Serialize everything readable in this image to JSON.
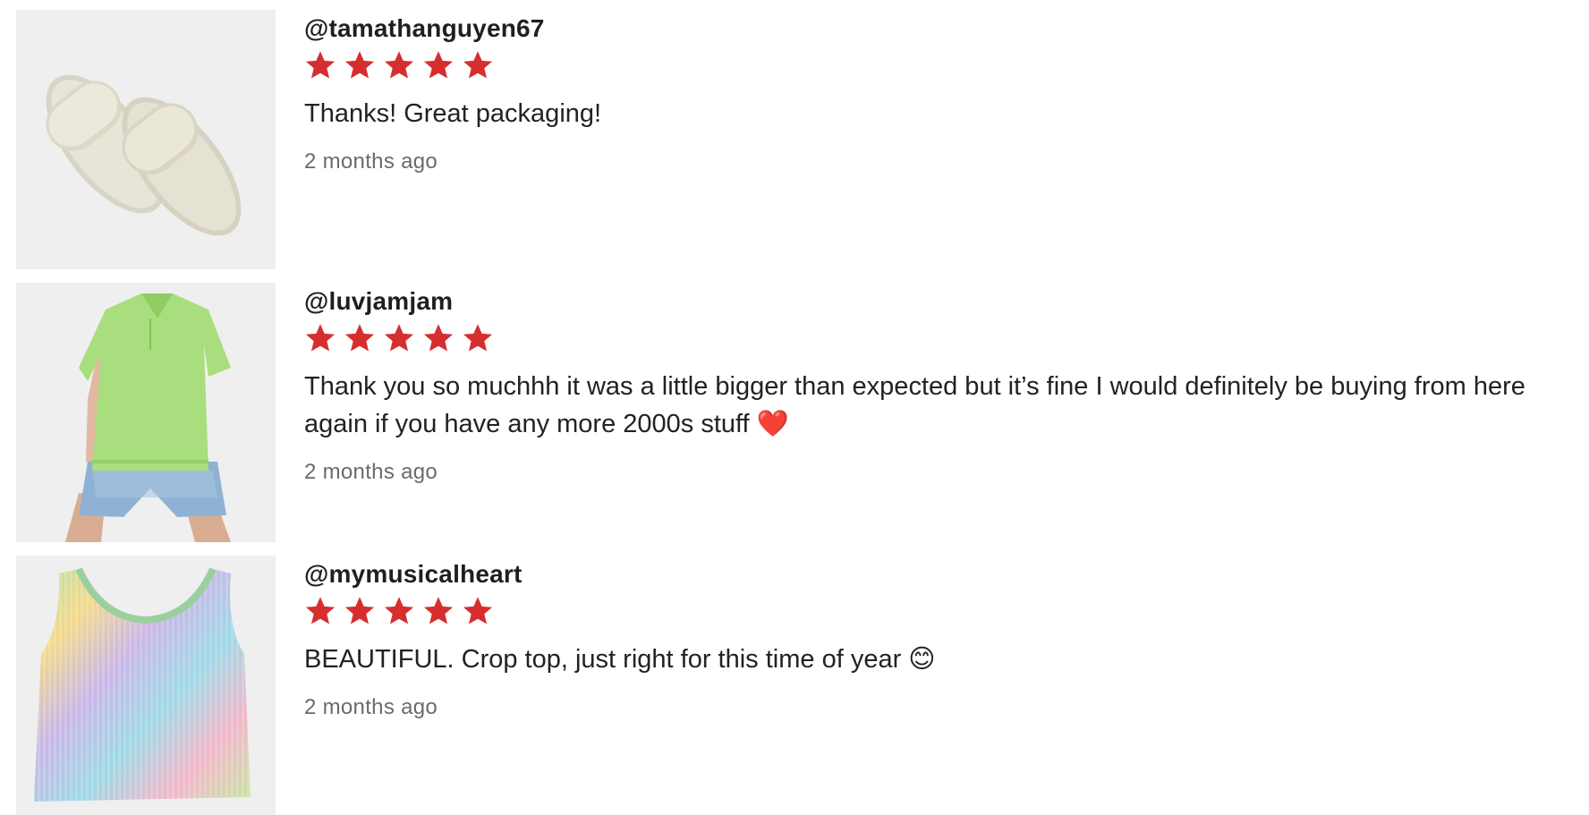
{
  "reviews": [
    {
      "handle": "@tamathanguyen67",
      "rating": 5,
      "text": "Thanks! Great packaging!",
      "time": "2 months ago",
      "image_icon": "slides-sandals-photo"
    },
    {
      "handle": "@luvjamjam",
      "rating": 5,
      "text": "Thank you so muchhh it was a little bigger than expected but it’s fine I would definitely be buying from here again if you have any more 2000s stuff ❤️",
      "time": "2 months ago",
      "image_icon": "green-polo-shirt-photo"
    },
    {
      "handle": "@mymusicalheart",
      "rating": 5,
      "text": "BEAUTIFUL. Crop top, just right for this time of year 😊",
      "time": "2 months ago",
      "image_icon": "knit-crop-top-photo"
    }
  ],
  "colors": {
    "star": "#d62e2e",
    "thumb_bg": "#efefef",
    "muted_text": "#6b6b6b"
  }
}
